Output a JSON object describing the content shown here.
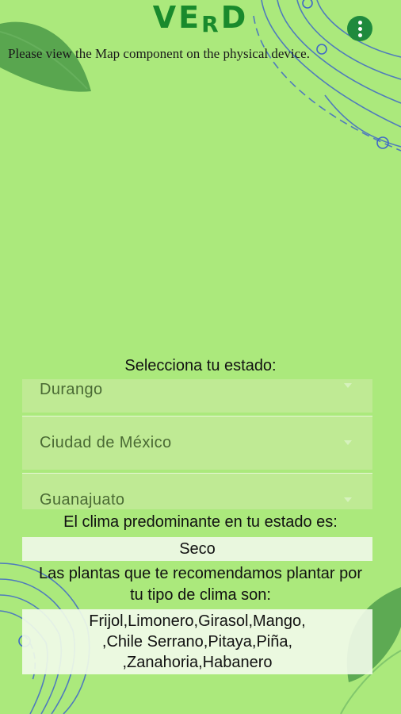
{
  "header": {
    "logo_part1": "V",
    "logo_part2": "E",
    "logo_part3": "R",
    "logo_part4": "D",
    "menu_icon": "more-vert-icon"
  },
  "map": {
    "message": "Please view the Map component on the physical device."
  },
  "state_selector": {
    "label": "Selecciona tu estado:",
    "options": [
      "Durango",
      "Ciudad de México",
      "Guanajuato"
    ]
  },
  "climate": {
    "label": "El clima predominante en tu estado es:",
    "value": "Seco"
  },
  "plants": {
    "label_line1": "Las plantas que te recomendamos plantar por",
    "label_line2": "tu tipo de clima son:",
    "line1": "Frijol,Limonero,Girasol,Mango,",
    "line2": ",Chile Serrano,Pitaya,Piña,",
    "line3": ",Zanahoria,Habanero"
  },
  "colors": {
    "background": "#abe97c",
    "brand_green": "#198a2c",
    "leaf_green": "#4a9a48",
    "line_blue": "#3f68c8"
  }
}
